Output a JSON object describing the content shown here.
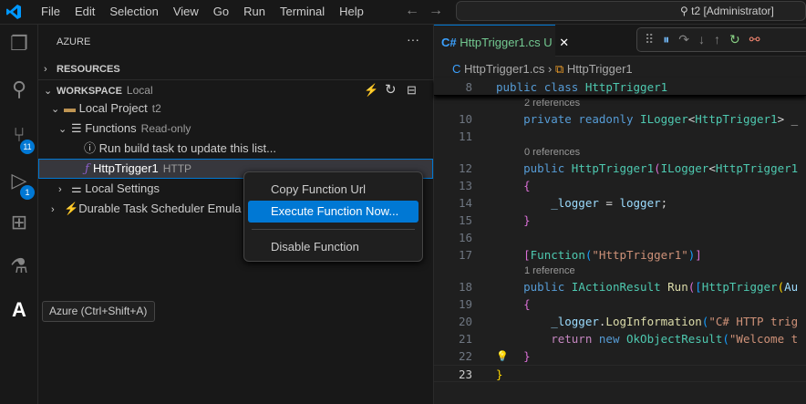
{
  "titlebar": {
    "menu": [
      "File",
      "Edit",
      "Selection",
      "View",
      "Go",
      "Run",
      "Terminal",
      "Help"
    ],
    "search": "t2 [Administrator]"
  },
  "activity": {
    "scm_badge": "11",
    "debug_badge": "1",
    "tooltip": "Azure (Ctrl+Shift+A)"
  },
  "sidebar": {
    "title": "AZURE",
    "resources": "RESOURCES",
    "workspace": "WORKSPACE",
    "workspace_desc": "Local",
    "project": "Local Project",
    "project_desc": "t2",
    "functions": "Functions",
    "functions_desc": "Read-only",
    "info": "Run build task to update this list...",
    "function": "HttpTrigger1",
    "function_desc": "HTTP",
    "settings": "Local Settings",
    "durable": "Durable Task Scheduler Emula"
  },
  "context_menu": [
    "Copy Function Url",
    "Execute Function Now...",
    "Disable Function"
  ],
  "editor": {
    "tab": "HttpTrigger1.cs",
    "tab_status": "U",
    "crumb_file": "HttpTrigger1.cs",
    "crumb_class": "HttpTrigger1",
    "lines": [
      {
        "n": "8",
        "tokens": [
          [
            "public ",
            "k"
          ],
          [
            "class ",
            "k"
          ],
          [
            "HttpTrigger1",
            "t"
          ]
        ],
        "sticky": true
      },
      {
        "lens": "2 references"
      },
      {
        "n": "10",
        "tokens": [
          [
            "    private ",
            "k"
          ],
          [
            "readonly ",
            "k"
          ],
          [
            "ILogger",
            "t"
          ],
          [
            "<",
            "p"
          ],
          [
            "HttpTrigger1",
            "t"
          ],
          [
            "> _",
            "p"
          ]
        ]
      },
      {
        "n": "11",
        "tokens": []
      },
      {
        "lens": "0 references"
      },
      {
        "n": "12",
        "tokens": [
          [
            "    public ",
            "k"
          ],
          [
            "HttpTrigger1",
            "t"
          ],
          [
            "(",
            "b2"
          ],
          [
            "ILogger",
            "t"
          ],
          [
            "<",
            "p"
          ],
          [
            "HttpTrigger1",
            "t"
          ]
        ]
      },
      {
        "n": "13",
        "tokens": [
          [
            "    {",
            "b2"
          ]
        ]
      },
      {
        "n": "14",
        "tokens": [
          [
            "        _logger",
            "v"
          ],
          [
            " = ",
            "p"
          ],
          [
            "logger",
            "v"
          ],
          [
            ";",
            "p"
          ]
        ]
      },
      {
        "n": "15",
        "tokens": [
          [
            "    }",
            "b2"
          ]
        ]
      },
      {
        "n": "16",
        "tokens": []
      },
      {
        "n": "17",
        "tokens": [
          [
            "    [",
            "b2"
          ],
          [
            "Function",
            "t"
          ],
          [
            "(",
            "b3"
          ],
          [
            "\"HttpTrigger1\"",
            "s"
          ],
          [
            ")",
            "b3"
          ],
          [
            "]",
            "b2"
          ]
        ]
      },
      {
        "lens": "1 reference"
      },
      {
        "n": "18",
        "tokens": [
          [
            "    public ",
            "k"
          ],
          [
            "IActionResult ",
            "t"
          ],
          [
            "Run",
            "m"
          ],
          [
            "(",
            "b2"
          ],
          [
            "[",
            "b3"
          ],
          [
            "HttpTrigger",
            "t"
          ],
          [
            "(",
            "b1"
          ],
          [
            "Au",
            "v"
          ]
        ]
      },
      {
        "n": "19",
        "tokens": [
          [
            "    {",
            "b2"
          ]
        ]
      },
      {
        "n": "20",
        "tokens": [
          [
            "        _logger",
            "v"
          ],
          [
            ".",
            "p"
          ],
          [
            "LogInformation",
            "m"
          ],
          [
            "(",
            "b3"
          ],
          [
            "\"C# HTTP trig",
            "s"
          ]
        ]
      },
      {
        "n": "21",
        "tokens": [
          [
            "        return ",
            "c"
          ],
          [
            "new ",
            "k"
          ],
          [
            "OkObjectResult",
            "t"
          ],
          [
            "(",
            "b3"
          ],
          [
            "\"Welcome t",
            "s"
          ]
        ]
      },
      {
        "n": "22",
        "tokens": [
          [
            "    }",
            "b2"
          ]
        ]
      },
      {
        "n": "23",
        "tokens": [
          [
            "}",
            "b1"
          ]
        ]
      }
    ]
  }
}
